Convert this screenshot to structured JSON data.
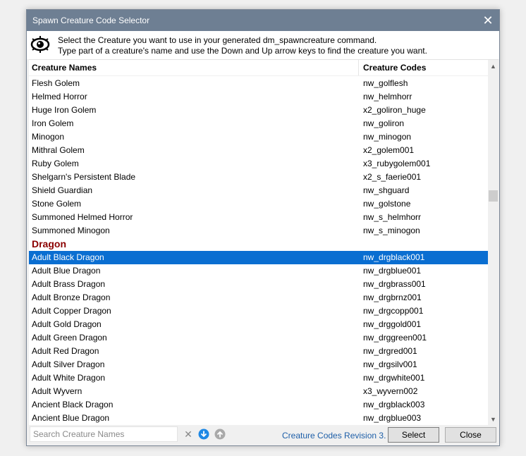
{
  "window": {
    "title": "Spawn Creature Code Selector",
    "close_glyph": "✕"
  },
  "header": {
    "line1": "Select the Creature you want to use in your generated dm_spawncreature command.",
    "line2": "Type part of a creature's name and use the Down and Up arrow keys to find the creature you want."
  },
  "columns": {
    "name": "Creature Names",
    "code": "Creature Codes"
  },
  "rows": [
    {
      "name": "Flesh Golem",
      "code": "nw_golflesh"
    },
    {
      "name": "Helmed Horror",
      "code": "nw_helmhorr"
    },
    {
      "name": "Huge Iron Golem",
      "code": "x2_goliron_huge"
    },
    {
      "name": "Iron Golem",
      "code": "nw_goliron"
    },
    {
      "name": "Minogon",
      "code": "nw_minogon"
    },
    {
      "name": "Mithral Golem",
      "code": "x2_golem001"
    },
    {
      "name": "Ruby Golem",
      "code": "x3_rubygolem001"
    },
    {
      "name": "Shelgarn's Persistent Blade",
      "code": "x2_s_faerie001"
    },
    {
      "name": "Shield Guardian",
      "code": "nw_shguard"
    },
    {
      "name": "Stone Golem",
      "code": "nw_golstone"
    },
    {
      "name": "Summoned Helmed Horror",
      "code": "nw_s_helmhorr"
    },
    {
      "name": "Summoned Minogon",
      "code": "nw_s_minogon"
    },
    {
      "name": "Dragon",
      "code": "",
      "group": true
    },
    {
      "name": "Adult Black Dragon",
      "code": "nw_drgblack001",
      "selected": true
    },
    {
      "name": "Adult Blue Dragon",
      "code": "nw_drgblue001"
    },
    {
      "name": "Adult Brass Dragon",
      "code": "nw_drgbrass001"
    },
    {
      "name": "Adult Bronze Dragon",
      "code": "nw_drgbrnz001"
    },
    {
      "name": "Adult Copper Dragon",
      "code": "nw_drgcopp001"
    },
    {
      "name": "Adult Gold Dragon",
      "code": "nw_drggold001"
    },
    {
      "name": "Adult Green Dragon",
      "code": "nw_drggreen001"
    },
    {
      "name": "Adult Red Dragon",
      "code": "nw_drgred001"
    },
    {
      "name": "Adult Silver Dragon",
      "code": "nw_drgsilv001"
    },
    {
      "name": "Adult White Dragon",
      "code": "nw_drgwhite001"
    },
    {
      "name": "Adult Wyvern",
      "code": "x3_wyvern002"
    },
    {
      "name": "Ancient Black Dragon",
      "code": "nw_drgblack003"
    },
    {
      "name": "Ancient Blue Dragon",
      "code": "nw_drgblue003"
    }
  ],
  "scrollbar": {
    "up_glyph": "▲",
    "down_glyph": "▼",
    "position_fraction": 0.36,
    "visible_fraction": 0.03
  },
  "footer": {
    "search_placeholder": "Search Creature Names",
    "search_value": "",
    "clear_glyph": "✕",
    "revision_link": "Creature Codes Revision 3.",
    "select_label": "Select",
    "close_label": "Close"
  },
  "colors": {
    "titlebar": "#6e7f93",
    "selection": "#0a6ed1",
    "group_header": "#8b0000",
    "link": "#1e5fa8",
    "arrow_down_active": "#1e88e5",
    "arrow_up_inactive": "#a9a9a9"
  },
  "icons": {
    "header": "eye-icon",
    "titlebar_close": "close-icon",
    "clear": "clear-icon",
    "find_next": "arrow-down-circle-icon",
    "find_prev": "arrow-up-circle-icon"
  }
}
